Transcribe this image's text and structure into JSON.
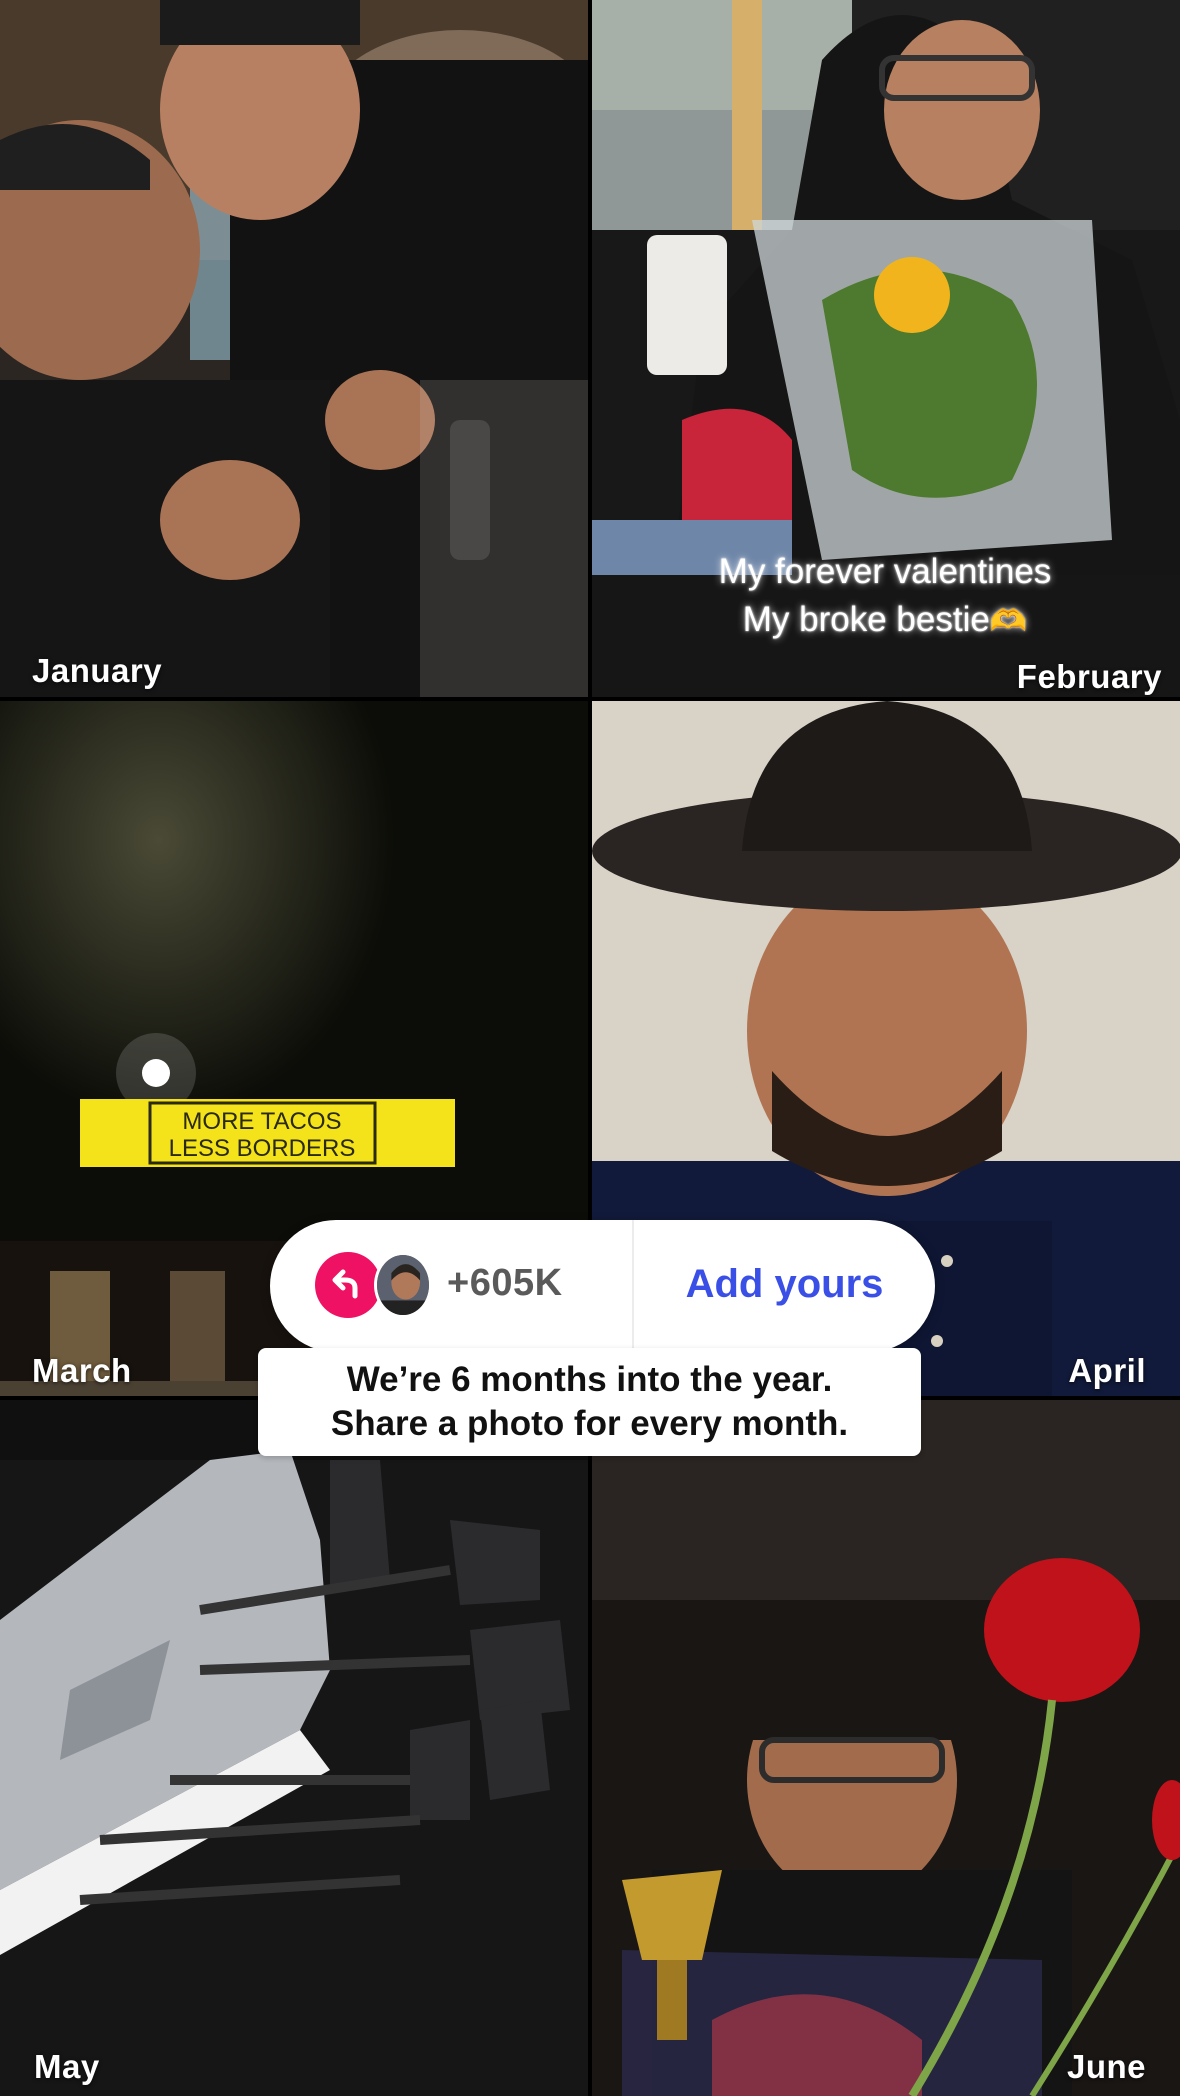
{
  "months": [
    "January",
    "February",
    "March",
    "April",
    "May",
    "June"
  ],
  "february_caption": {
    "line1": "My forever valentines",
    "line2": "My broke bestie",
    "emoji": "🫶"
  },
  "sign_text": {
    "line1": "MORE TACOS",
    "line2": "LESS BORDERS"
  },
  "add_yours_sticker": {
    "participants": "+605K",
    "button_label": "Add yours",
    "icon": "reply-arrow-icon",
    "accent_color": "#ee1164",
    "button_color": "#3a4fe6"
  },
  "prompt": {
    "line1": "We’re 6 months into the year.",
    "line2": "Share a photo for every month."
  }
}
